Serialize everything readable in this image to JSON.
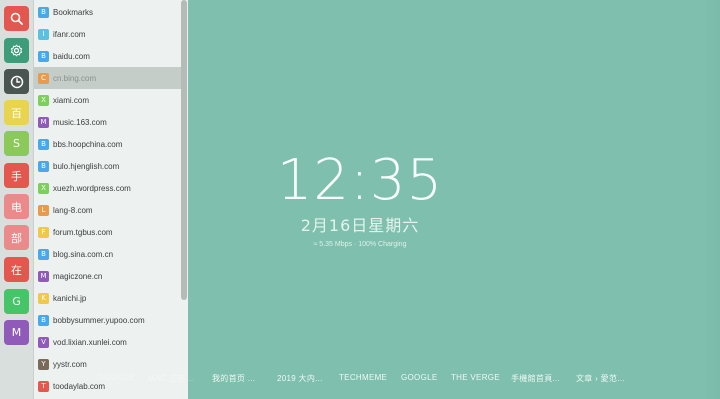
{
  "rail": {
    "buttons": [
      {
        "name": "search-button",
        "color": "#e4574e",
        "icon": "search-icon",
        "label": ""
      },
      {
        "name": "settings-button",
        "color": "#3d9c7a",
        "icon": "gear-icon",
        "label": ""
      },
      {
        "name": "history-button",
        "color": "#4a5450",
        "icon": "clock-icon",
        "label": ""
      },
      {
        "name": "rail-item-bai",
        "color": "#e8d44f",
        "icon": "",
        "label": "百"
      },
      {
        "name": "rail-item-s",
        "color": "#8bc95b",
        "icon": "",
        "label": "S"
      },
      {
        "name": "rail-item-shou",
        "color": "#e4574e",
        "icon": "",
        "label": "手"
      },
      {
        "name": "rail-item-dian",
        "color": "#ea8a8a",
        "icon": "",
        "label": "电"
      },
      {
        "name": "rail-item-bu",
        "color": "#ea8a8a",
        "icon": "",
        "label": "部"
      },
      {
        "name": "rail-item-zai",
        "color": "#e4574e",
        "icon": "",
        "label": "在"
      },
      {
        "name": "rail-item-g",
        "color": "#45c468",
        "icon": "",
        "label": "G"
      },
      {
        "name": "rail-item-m",
        "color": "#8f5ab8",
        "icon": "",
        "label": "M"
      }
    ]
  },
  "list": {
    "items": [
      {
        "letter": "B",
        "color": "#4aa8e8",
        "label": "Bookmarks"
      },
      {
        "letter": "I",
        "color": "#5bc1e0",
        "label": "ifanr.com"
      },
      {
        "letter": "B",
        "color": "#4aa8e8",
        "label": "baidu.com"
      },
      {
        "letter": "C",
        "color": "#e99a4b",
        "label": "cn.bing.com"
      },
      {
        "letter": "X",
        "color": "#7ccf5a",
        "label": "xiami.com"
      },
      {
        "letter": "M",
        "color": "#8f5ab8",
        "label": "music.163.com"
      },
      {
        "letter": "B",
        "color": "#4aa8e8",
        "label": "bbs.hoopchina.com"
      },
      {
        "letter": "B",
        "color": "#4aa8e8",
        "label": "bulo.hjenglish.com"
      },
      {
        "letter": "X",
        "color": "#7ccf5a",
        "label": "xuezh.wordpress.com"
      },
      {
        "letter": "L",
        "color": "#e99a4b",
        "label": "lang-8.com"
      },
      {
        "letter": "F",
        "color": "#f0c84a",
        "label": "forum.tgbus.com"
      },
      {
        "letter": "B",
        "color": "#4aa8e8",
        "label": "blog.sina.com.cn"
      },
      {
        "letter": "M",
        "color": "#8f5ab8",
        "label": "magiczone.cn"
      },
      {
        "letter": "K",
        "color": "#f0c84a",
        "label": "kanichi.jp"
      },
      {
        "letter": "B",
        "color": "#4aa8e8",
        "label": "bobbysummer.yupoo.com"
      },
      {
        "letter": "V",
        "color": "#8f5ab8",
        "label": "vod.lixian.xunlei.com"
      },
      {
        "letter": "Y",
        "color": "#7a6a5a",
        "label": "yystr.com"
      },
      {
        "letter": "T",
        "color": "#e4574e",
        "label": "toodaylab.com"
      }
    ],
    "active_index": 3
  },
  "clock": {
    "time": "12:35",
    "date": "2月16日星期六",
    "status": "≈ 5.35 Mbps · 100% Charging"
  },
  "bottom_links": [
    {
      "label": "GOOGLE",
      "faded": true
    },
    {
      "label": "MAC 正在...",
      "faded": true
    },
    {
      "label": "我的首页 ...",
      "faded": false
    },
    {
      "label": "2019 大内...",
      "faded": false
    },
    {
      "label": "TECHMEME",
      "faded": false
    },
    {
      "label": "GOOGLE",
      "faded": false
    },
    {
      "label": "THE VERGE",
      "faded": false
    },
    {
      "label": "手機館首頁...",
      "faded": false
    },
    {
      "label": "文章 › 愛范...",
      "faded": false
    }
  ]
}
